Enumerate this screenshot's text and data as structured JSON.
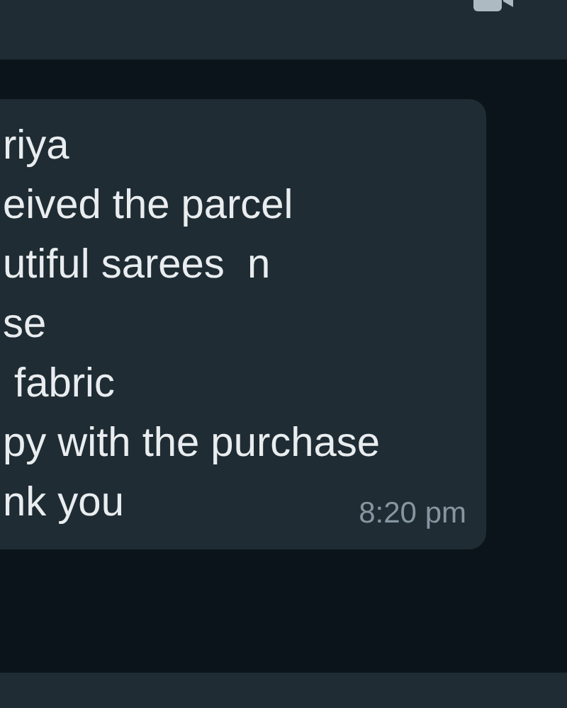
{
  "message": {
    "lines": [
      "riya",
      "eived the parcel",
      "utiful sarees  n",
      "se",
      " fabric",
      "py with the purchase",
      "nk you"
    ],
    "time": "8:20 pm"
  }
}
